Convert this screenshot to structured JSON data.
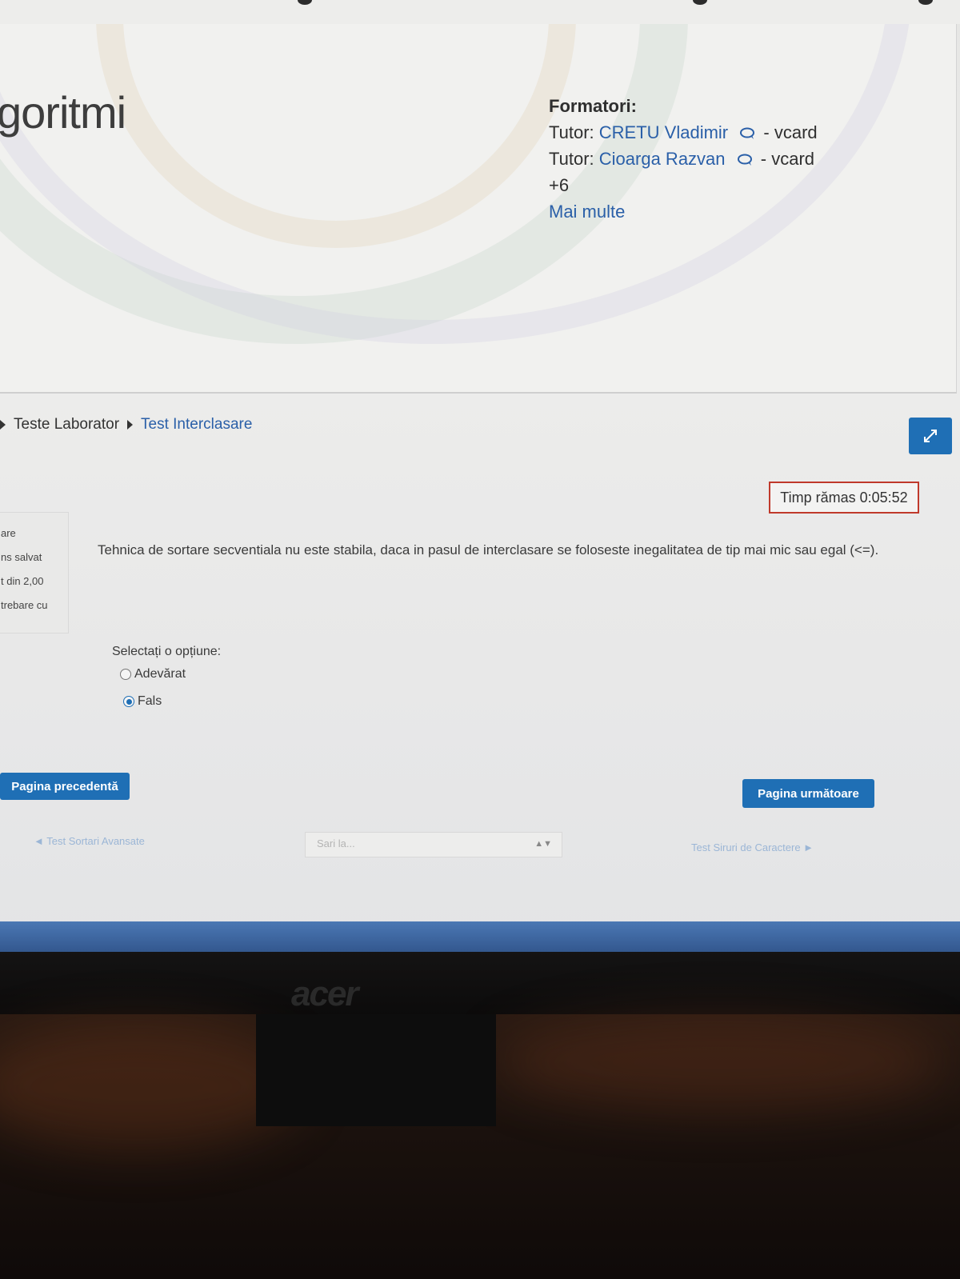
{
  "course": {
    "title_partial": "goritmi"
  },
  "formatori": {
    "heading": "Formatori:",
    "tutors": [
      {
        "prefix": "Tutor:",
        "name": "CRETU Vladimir",
        "suffix": "- vcard"
      },
      {
        "prefix": "Tutor:",
        "name": "Cioarga Razvan",
        "suffix": "- vcard"
      }
    ],
    "more_count": "+6",
    "more_link": "Mai multe"
  },
  "breadcrumb": {
    "items": [
      "Teste Laborator",
      "Test Interclasare"
    ]
  },
  "timer": {
    "text": "Timp rămas 0:05:52"
  },
  "question_info": {
    "lines": [
      "are",
      "ns salvat",
      "t din 2,00",
      "trebare cu"
    ]
  },
  "question": {
    "text": "Tehnica de sortare secventiala nu este stabila, daca in pasul de interclasare se foloseste inegalitatea de tip mai mic sau egal (<=).",
    "prompt": "Selectați o opțiune:",
    "options": [
      {
        "label": "Adevărat",
        "selected": false
      },
      {
        "label": "Fals",
        "selected": true
      }
    ]
  },
  "navigation": {
    "prev_label": "Pagina precedentă",
    "next_label": "Pagina următoare"
  },
  "activity_nav": {
    "prev_activity": "◄ Test Sortari Avansate",
    "jump_placeholder": "Sari la...",
    "next_activity": "Test Siruri de Caractere ►"
  },
  "monitor": {
    "brand": "acer"
  },
  "colors": {
    "link": "#2a5fa8",
    "primary_button": "#1f6fb5",
    "timer_border": "#c0392b"
  }
}
